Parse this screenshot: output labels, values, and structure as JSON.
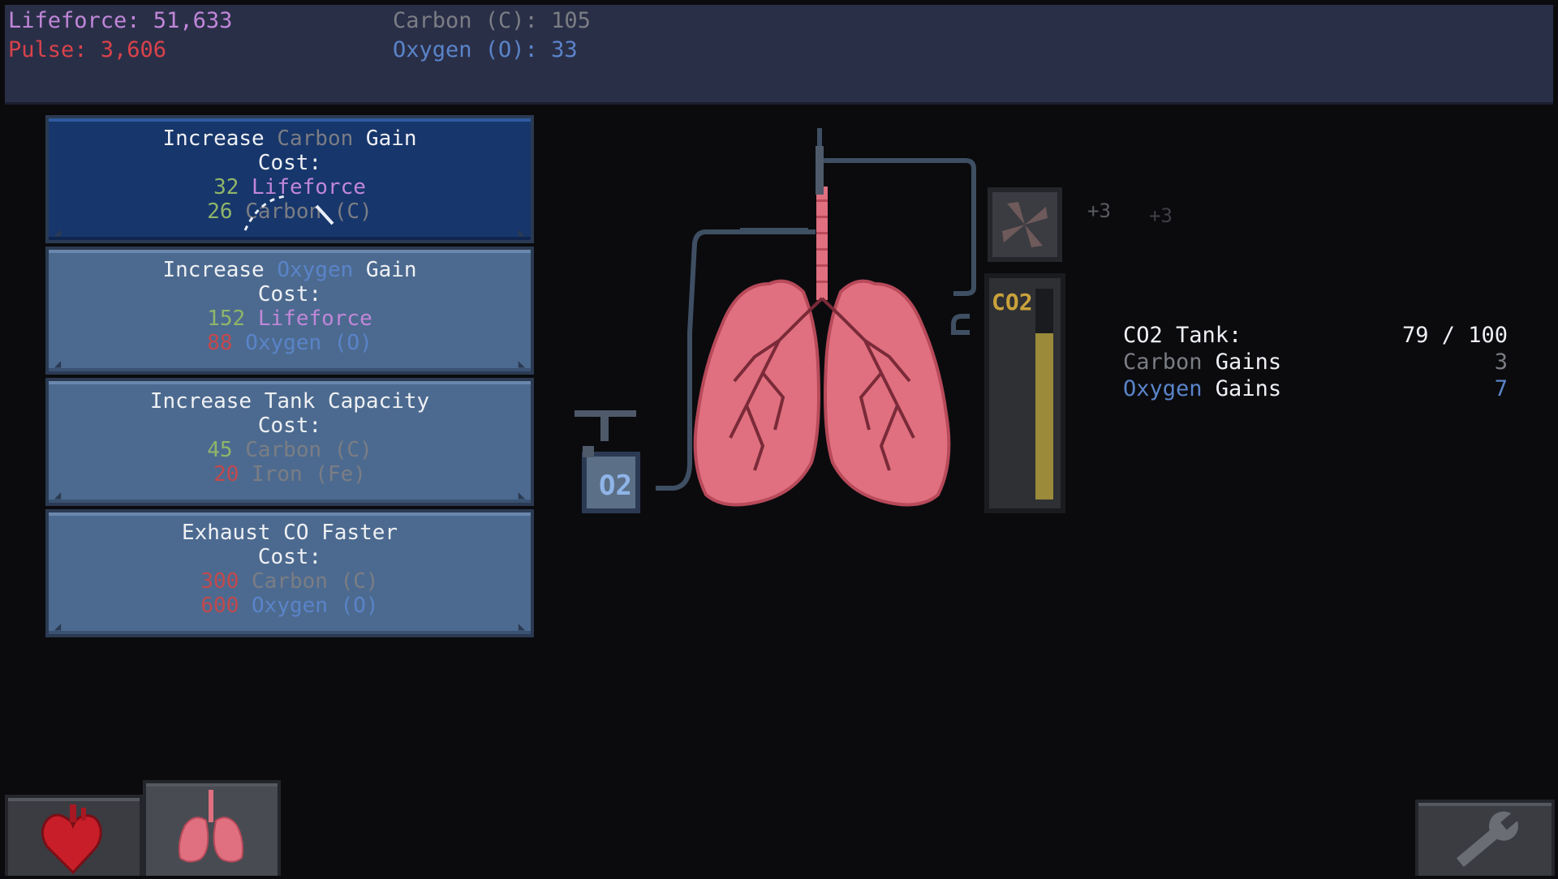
{
  "resources": {
    "lifeforce": "Lifeforce: 51,633",
    "pulse": "Pulse: 3,606",
    "carbon": "Carbon (C): 105",
    "oxygen": "Oxygen (O): 33"
  },
  "upgrades": [
    {
      "title_pre": "Increase ",
      "title_hl": "Carbon",
      "title_post": " Gain",
      "cost_label": "Cost:",
      "cost1_amount": "32",
      "cost1_name": "Lifeforce",
      "cost2_amount": "26",
      "cost2_name": "Carbon (C)"
    },
    {
      "title_pre": "Increase ",
      "title_hl": "Oxygen",
      "title_post": " Gain",
      "cost_label": "Cost:",
      "cost1_amount": "152",
      "cost1_name": "Lifeforce",
      "cost2_amount": "88",
      "cost2_name": "Oxygen (O)"
    },
    {
      "title": "Increase Tank Capacity",
      "cost_label": "Cost:",
      "cost1_amount": "45",
      "cost1_name": "Carbon (C)",
      "cost2_amount": "20",
      "cost2_name": "Iron (Fe)"
    },
    {
      "title": "Exhaust CO Faster",
      "cost_label": "Cost:",
      "cost1_amount": "300",
      "cost1_name": "Carbon (C)",
      "cost2_amount": "600",
      "cost2_name": "Oxygen (O)"
    }
  ],
  "machine": {
    "plus_a": "+3",
    "plus_b": "+3",
    "o2_label": "O2",
    "co2_label": "CO2",
    "tank_fill": 0.79
  },
  "stats": {
    "tank_label": "CO2 Tank:",
    "tank_value": "79 / 100",
    "carbon_hl": "Carbon",
    "carbon_rest": " Gains",
    "carbon_value": "3",
    "oxygen_hl": "Oxygen",
    "oxygen_rest": " Gains",
    "oxygen_value": "7"
  },
  "colors": {
    "lifeforce": "#c087d8",
    "pulse": "#d9424a",
    "carbon": "#7b7d84",
    "oxygen": "#5a84c9",
    "lung": "#e0707f",
    "tank_fill": "#9a8a3a"
  },
  "tabs": [
    {
      "icon": "heart-icon"
    },
    {
      "icon": "lungs-icon"
    },
    {
      "icon": "wrench-icon"
    }
  ]
}
